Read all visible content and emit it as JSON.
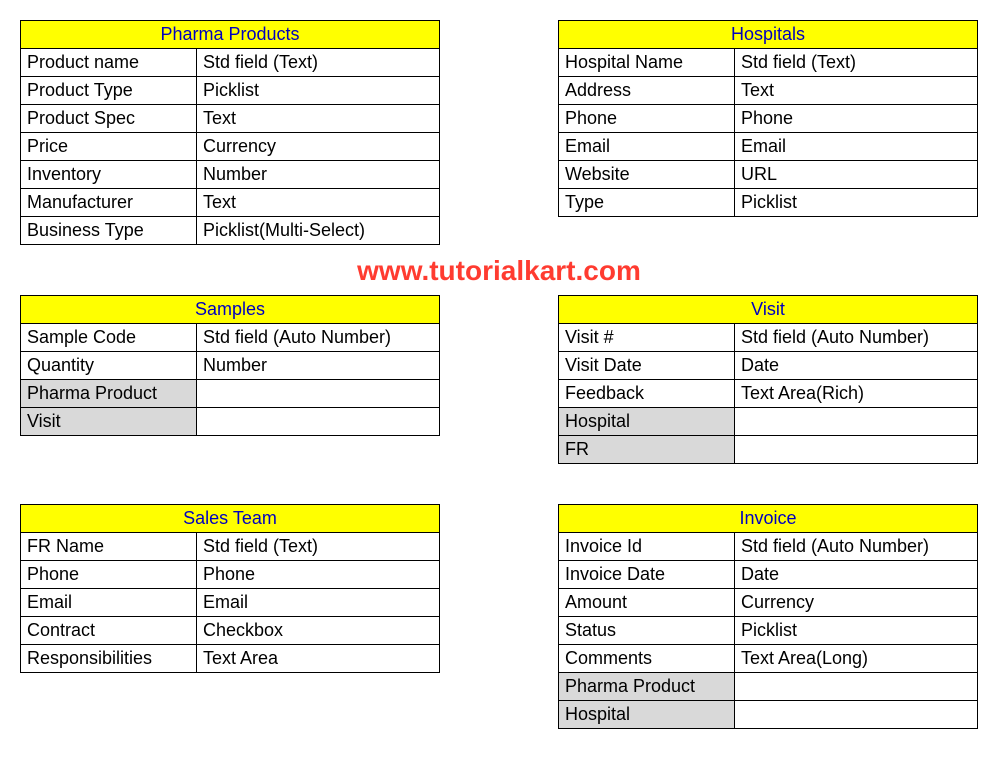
{
  "watermark": "www.tutorialkart.com",
  "tables": {
    "pharma": {
      "title": "Pharma Products",
      "rows": [
        {
          "label": "Product name",
          "value": "Std field (Text)"
        },
        {
          "label": "Product Type",
          "value": "Picklist"
        },
        {
          "label": "Product Spec",
          "value": "Text"
        },
        {
          "label": "Price",
          "value": "Currency"
        },
        {
          "label": "Inventory",
          "value": "Number"
        },
        {
          "label": "Manufacturer",
          "value": "Text"
        },
        {
          "label": "Business Type",
          "value": "Picklist(Multi-Select)"
        }
      ]
    },
    "hospitals": {
      "title": "Hospitals",
      "rows": [
        {
          "label": "Hospital Name",
          "value": "Std field (Text)"
        },
        {
          "label": "Address",
          "value": "Text"
        },
        {
          "label": "Phone",
          "value": "Phone"
        },
        {
          "label": "Email",
          "value": "Email"
        },
        {
          "label": "Website",
          "value": "URL"
        },
        {
          "label": "Type",
          "value": "Picklist"
        }
      ]
    },
    "samples": {
      "title": "Samples",
      "rows": [
        {
          "label": "Sample Code",
          "value": "Std field (Auto Number)"
        },
        {
          "label": "Quantity",
          "value": "Number"
        },
        {
          "label": "Pharma Product",
          "value": "",
          "grey": true
        },
        {
          "label": "Visit",
          "value": "",
          "grey": true
        }
      ]
    },
    "visit": {
      "title": "Visit",
      "rows": [
        {
          "label": "Visit #",
          "value": "Std field (Auto Number)"
        },
        {
          "label": "Visit Date",
          "value": "Date"
        },
        {
          "label": "Feedback",
          "value": "Text Area(Rich)"
        },
        {
          "label": "Hospital",
          "value": "",
          "grey": true
        },
        {
          "label": "FR",
          "value": "",
          "grey": true
        }
      ]
    },
    "salesteam": {
      "title": "Sales Team",
      "rows": [
        {
          "label": "FR Name",
          "value": "Std field (Text)"
        },
        {
          "label": "Phone",
          "value": "Phone"
        },
        {
          "label": "Email",
          "value": "Email"
        },
        {
          "label": "Contract",
          "value": "Checkbox"
        },
        {
          "label": "Responsibilities",
          "value": "Text Area"
        }
      ]
    },
    "invoice": {
      "title": "Invoice",
      "rows": [
        {
          "label": "Invoice Id",
          "value": "Std field (Auto Number)"
        },
        {
          "label": "Invoice Date",
          "value": "Date"
        },
        {
          "label": "Amount",
          "value": "Currency"
        },
        {
          "label": "Status",
          "value": "Picklist"
        },
        {
          "label": "Comments",
          "value": "Text Area(Long)"
        },
        {
          "label": "Pharma Product",
          "value": "",
          "grey": true
        },
        {
          "label": "Hospital",
          "value": "",
          "grey": true
        }
      ]
    }
  }
}
